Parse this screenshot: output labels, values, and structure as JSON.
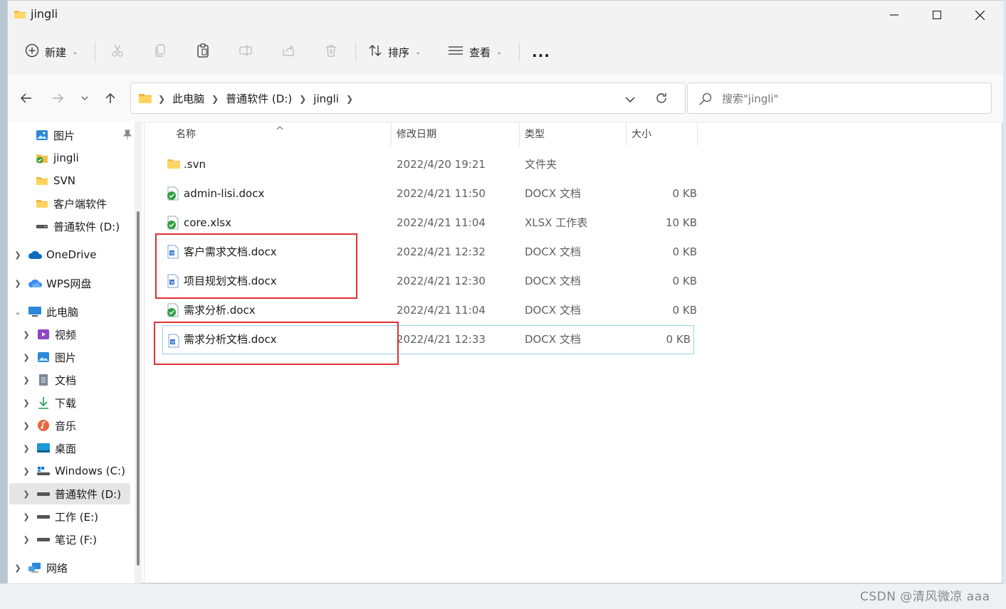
{
  "window": {
    "title": "jingli"
  },
  "toolbar": {
    "new_label": "新建",
    "sort_label": "排序",
    "view_label": "查看",
    "more_label": "..."
  },
  "address": {
    "segments": [
      "此电脑",
      "普通软件 (D:)",
      "jingli"
    ]
  },
  "search": {
    "placeholder": "搜索\"jingli\""
  },
  "sidebar": {
    "items": [
      {
        "label": "图片",
        "icon": "pictures-icon",
        "pinned": true
      },
      {
        "label": "jingli",
        "icon": "svn-folder-icon"
      },
      {
        "label": "SVN",
        "icon": "folder-icon"
      },
      {
        "label": "客户端软件",
        "icon": "folder-icon"
      },
      {
        "label": "普通软件 (D:)",
        "icon": "drive-icon"
      },
      {
        "label": "OneDrive",
        "icon": "onedrive-icon"
      },
      {
        "label": "WPS网盘",
        "icon": "wps-cloud-icon"
      },
      {
        "label": "此电脑",
        "icon": "this-pc-icon"
      },
      {
        "label": "视频",
        "icon": "videos-icon"
      },
      {
        "label": "图片",
        "icon": "pictures-icon"
      },
      {
        "label": "文档",
        "icon": "documents-icon"
      },
      {
        "label": "下载",
        "icon": "downloads-icon"
      },
      {
        "label": "音乐",
        "icon": "music-icon"
      },
      {
        "label": "桌面",
        "icon": "desktop-icon"
      },
      {
        "label": "Windows (C:)",
        "icon": "windows-drive-icon"
      },
      {
        "label": "普通软件 (D:)",
        "icon": "drive-icon",
        "selected": true
      },
      {
        "label": "工作 (E:)",
        "icon": "drive-icon"
      },
      {
        "label": "笔记 (F:)",
        "icon": "drive-icon"
      },
      {
        "label": "网络",
        "icon": "network-icon"
      }
    ]
  },
  "columns": {
    "name": "名称",
    "date": "修改日期",
    "type": "类型",
    "size": "大小"
  },
  "files": [
    {
      "name": ".svn",
      "date": "2022/4/20 19:21",
      "type": "文件夹",
      "size": "",
      "icon": "folder-icon"
    },
    {
      "name": "admin-lisi.docx",
      "date": "2022/4/21 11:50",
      "type": "DOCX 文档",
      "size": "0 KB",
      "icon": "svn-ok-file-icon"
    },
    {
      "name": "core.xlsx",
      "date": "2022/4/21 11:04",
      "type": "XLSX 工作表",
      "size": "10 KB",
      "icon": "svn-ok-file-icon"
    },
    {
      "name": "客户需求文档.docx",
      "date": "2022/4/21 12:32",
      "type": "DOCX 文档",
      "size": "0 KB",
      "icon": "word-doc-icon"
    },
    {
      "name": "项目规划文档.docx",
      "date": "2022/4/21 12:30",
      "type": "DOCX 文档",
      "size": "0 KB",
      "icon": "word-doc-icon"
    },
    {
      "name": "需求分析.docx",
      "date": "2022/4/21 11:04",
      "type": "DOCX 文档",
      "size": "0 KB",
      "icon": "svn-ok-file-icon"
    },
    {
      "name": "需求分析文档.docx",
      "date": "2022/4/21 12:33",
      "type": "DOCX 文档",
      "size": "0 KB",
      "icon": "word-doc-icon",
      "selected": true
    }
  ],
  "watermark": "CSDN @清风微凉 aaa",
  "colors": {
    "highlight_box": "#e03131",
    "accent": "#0067c0",
    "selection_border": "#99d1e8"
  }
}
